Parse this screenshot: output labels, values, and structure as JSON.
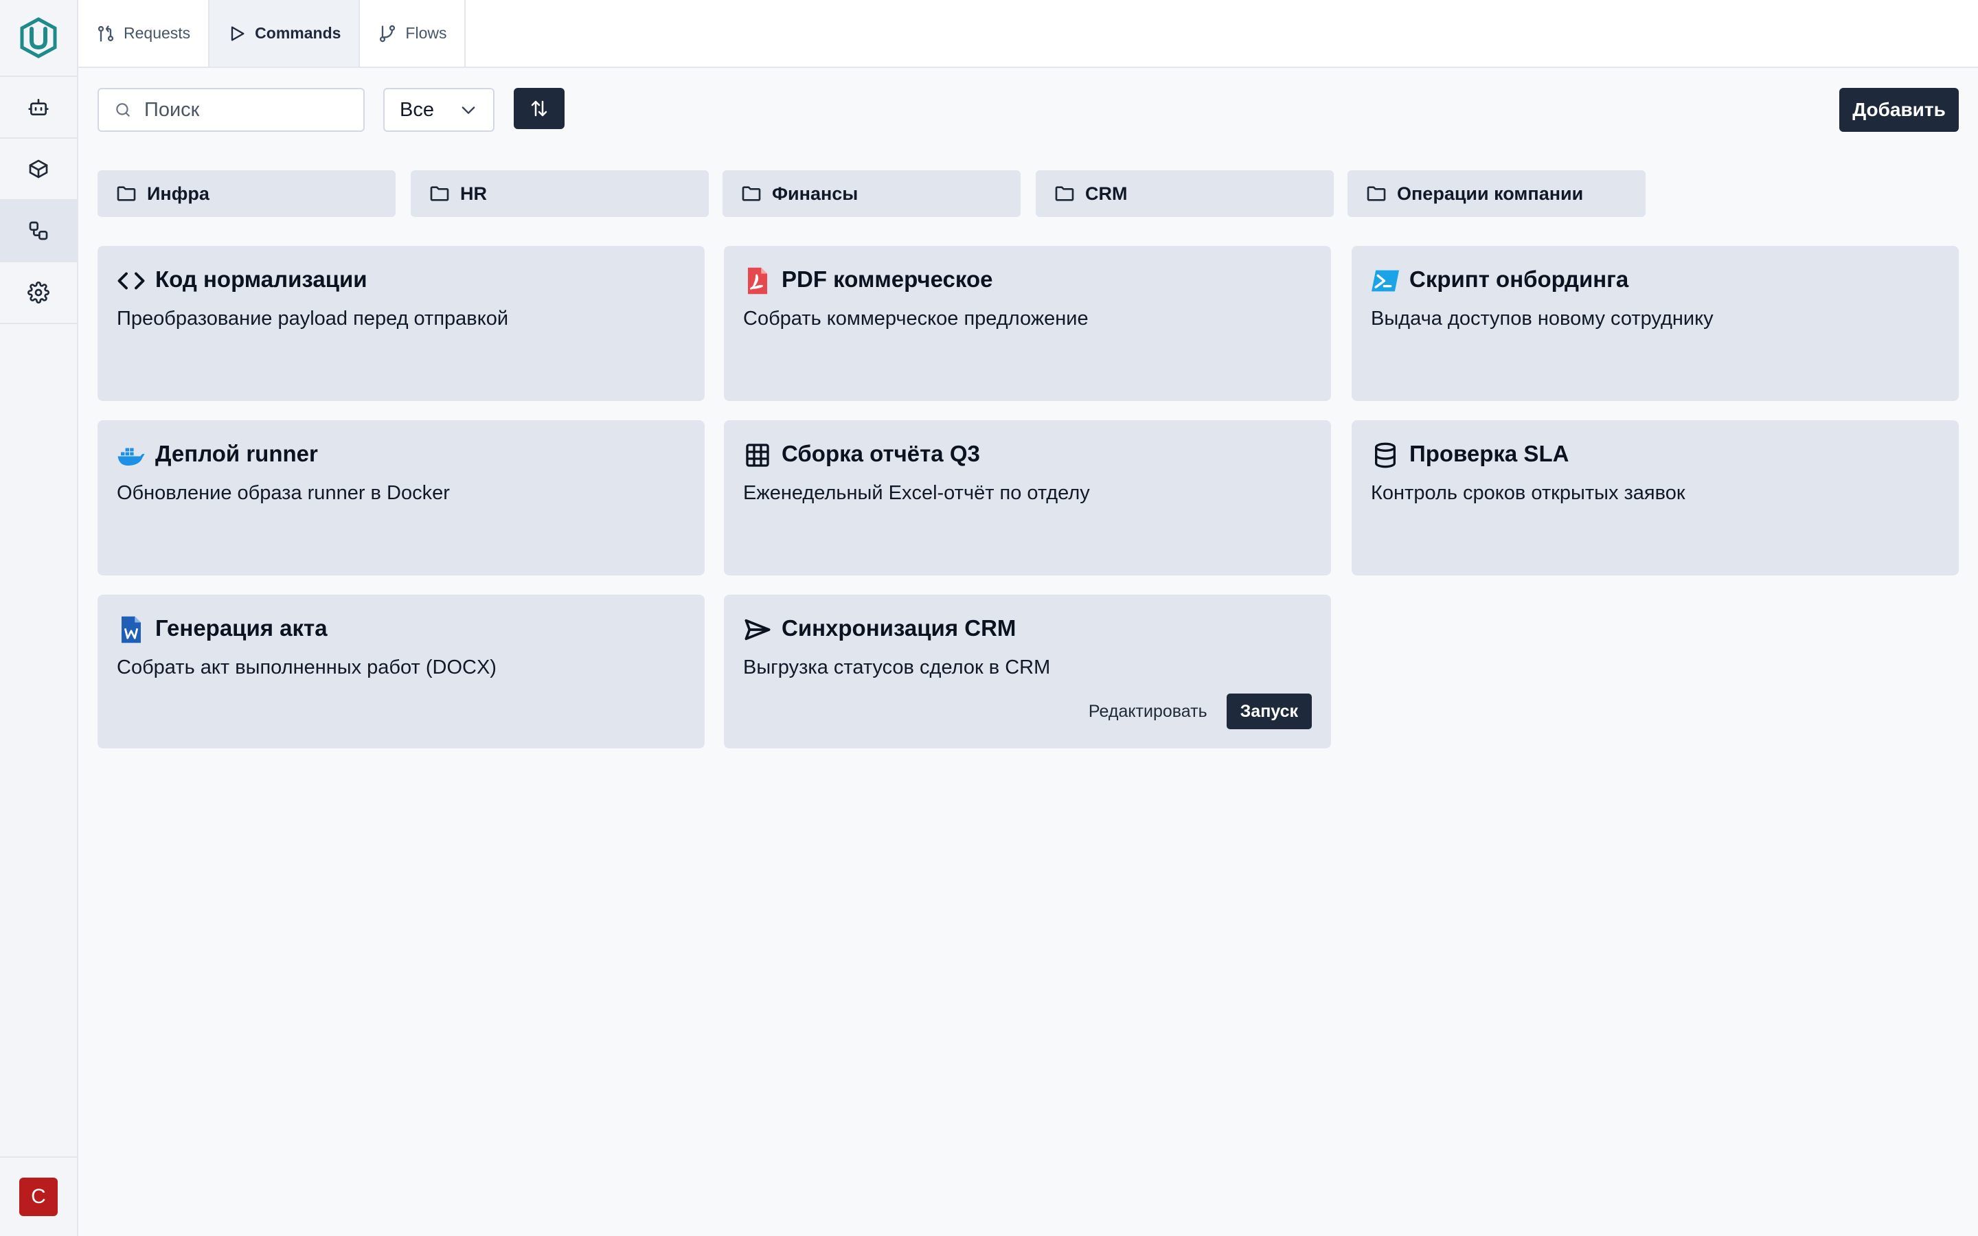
{
  "tabs": [
    {
      "label": "Requests",
      "icon": "git-pull-request-icon"
    },
    {
      "label": "Commands",
      "icon": "play-icon"
    },
    {
      "label": "Flows",
      "icon": "git-branch-icon"
    }
  ],
  "sidebar": {
    "items": [
      {
        "icon": "bot-icon"
      },
      {
        "icon": "box-icon"
      },
      {
        "icon": "workflow-icon"
      },
      {
        "icon": "gear-icon"
      }
    ],
    "avatar": "C"
  },
  "toolbar": {
    "search_placeholder": "Поиск",
    "filter_value": "Все",
    "add_label": "Добавить"
  },
  "folders": [
    {
      "label": "Инфра"
    },
    {
      "label": "HR"
    },
    {
      "label": "Финансы"
    },
    {
      "label": "CRM"
    },
    {
      "label": "Операции компании"
    }
  ],
  "cards": [
    {
      "title": "Код нормализации",
      "desc": "Преобразование payload перед отправкой",
      "icon": "code-icon"
    },
    {
      "title": "PDF коммерческое",
      "desc": "Собрать коммерческое предложение",
      "icon": "pdf-file-icon"
    },
    {
      "title": "Скрипт онбординга",
      "desc": "Выдача доступов новому сотруднику",
      "icon": "powershell-icon"
    },
    {
      "title": "Деплой runner",
      "desc": "Обновление образа runner в Docker",
      "icon": "docker-icon"
    },
    {
      "title": "Сборка отчёта Q3",
      "desc": "Еженедельный Excel-отчёт по отделу",
      "icon": "table-icon"
    },
    {
      "title": "Проверка SLA",
      "desc": "Контроль сроков открытых заявок",
      "icon": "database-icon"
    },
    {
      "title": "Генерация акта",
      "desc": "Собрать акт выполненных работ (DOCX)",
      "icon": "word-file-icon"
    },
    {
      "title": "Синхронизация CRM",
      "desc": "Выгрузка статусов сделок в CRM",
      "icon": "send-icon"
    }
  ],
  "card_actions": {
    "edit_label": "Редактировать",
    "run_label": "Запуск"
  },
  "colors": {
    "accent": "#1e293b",
    "card_bg": "#e1e6ee",
    "logo": "#1f8a8a",
    "avatar": "#b91c1c",
    "pdf": "#e5484d",
    "docker": "#1d91e6",
    "word": "#1f5fb8",
    "powershell": "#1aa3e6"
  }
}
